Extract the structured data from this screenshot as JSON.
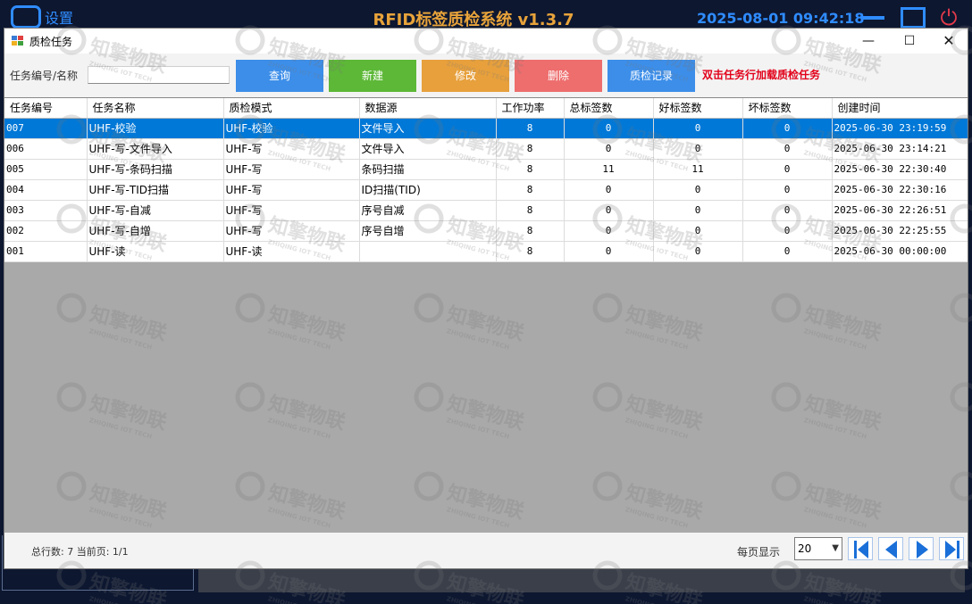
{
  "app": {
    "settings_label": "设置",
    "title": "RFID标签质检系统 v1.3.7",
    "clock": "2025-08-01 09:42:18"
  },
  "dialog": {
    "title": "质检任务",
    "window_controls": {
      "minimize": "—",
      "maximize": "☐",
      "close": "✕"
    }
  },
  "toolbar": {
    "search_label": "任务编号/名称",
    "search_value": "",
    "buttons": [
      {
        "label": "查询",
        "color": "#3c8ee9"
      },
      {
        "label": "新建",
        "color": "#5cb836"
      },
      {
        "label": "修改",
        "color": "#e7a03c"
      },
      {
        "label": "删除",
        "color": "#ee6d6d"
      },
      {
        "label": "质检记录",
        "color": "#3c8ee9"
      }
    ],
    "hint": "双击任务行加载质检任务"
  },
  "table": {
    "columns": [
      "任务编号",
      "任务名称",
      "质检模式",
      "数据源",
      "工作功率",
      "总标签数",
      "好标签数",
      "坏标签数",
      "创建时间"
    ],
    "rows": [
      [
        "007",
        "UHF-校验",
        "UHF-校验",
        "文件导入",
        "8",
        "0",
        "0",
        "0",
        "2025-06-30 23:19:59"
      ],
      [
        "006",
        "UHF-写-文件导入",
        "UHF-写",
        "文件导入",
        "8",
        "0",
        "0",
        "0",
        "2025-06-30 23:14:21"
      ],
      [
        "005",
        "UHF-写-条码扫描",
        "UHF-写",
        "条码扫描",
        "8",
        "11",
        "11",
        "0",
        "2025-06-30 22:30:40"
      ],
      [
        "004",
        "UHF-写-TID扫描",
        "UHF-写",
        "ID扫描(TID)",
        "8",
        "0",
        "0",
        "0",
        "2025-06-30 22:30:16"
      ],
      [
        "003",
        "UHF-写-自减",
        "UHF-写",
        "序号自减",
        "8",
        "0",
        "0",
        "0",
        "2025-06-30 22:26:51"
      ],
      [
        "002",
        "UHF-写-自增",
        "UHF-写",
        "序号自增",
        "8",
        "0",
        "0",
        "0",
        "2025-06-30 22:25:55"
      ],
      [
        "001",
        "UHF-读",
        "UHF-读",
        "",
        "8",
        "0",
        "0",
        "0",
        "2025-06-30 00:00:00"
      ]
    ],
    "selected_row": 0
  },
  "footer": {
    "total_text": "总行数: 7 当前页: 1/1",
    "per_page_label": "每页显示",
    "per_page_value": "20"
  },
  "pager_icons": [
    "first-page-icon",
    "prev-page-icon",
    "next-page-icon",
    "last-page-icon"
  ],
  "watermark": {
    "text": "知擎物联",
    "subtext": "ZHIQING IOT TECH"
  },
  "colors": {
    "accent_blue": "#2f8cff",
    "title_orange": "#e8a33a",
    "selection": "#0078d7",
    "hint_red": "#e2001a",
    "power_red": "#e23a4a"
  }
}
